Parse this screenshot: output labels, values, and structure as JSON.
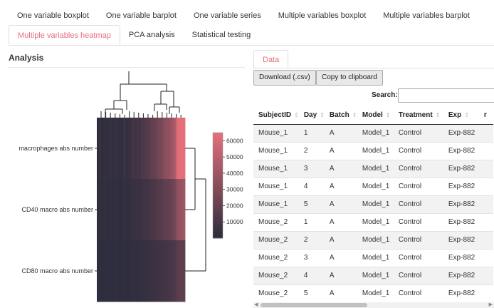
{
  "tabs_row1": [
    {
      "label": "One variable boxplot"
    },
    {
      "label": "One variable barplot"
    },
    {
      "label": "One variable series"
    },
    {
      "label": "Multiple variables boxplot"
    },
    {
      "label": "Multiple variables barplot"
    }
  ],
  "tabs_row2": [
    {
      "label": "Multiple variables heatmap",
      "active": true
    },
    {
      "label": "PCA analysis"
    },
    {
      "label": "Statistical testing"
    }
  ],
  "analysis": {
    "title": "Analysis"
  },
  "heatmap": {
    "row_labels": [
      "macrophages abs number",
      "CD40 macro abs number",
      "CD80 macro abs number"
    ],
    "legend_ticks": [
      60000,
      50000,
      40000,
      30000,
      20000,
      10000
    ],
    "legend_range": [
      0,
      65000
    ],
    "color_low": "#2d2d3e",
    "color_high": "#e46f7a"
  },
  "data_panel": {
    "tab_label": "Data",
    "download_label": "Download (.csv)",
    "clipboard_label": "Copy to clipboard",
    "search_label": "Search:",
    "search_value": ""
  },
  "table": {
    "columns": [
      "SubjectID",
      "Day",
      "Batch",
      "Model",
      "Treatment",
      "Exp",
      "r"
    ],
    "rows": [
      [
        "Mouse_1",
        "1",
        "A",
        "Model_1",
        "Control",
        "Exp-882"
      ],
      [
        "Mouse_1",
        "2",
        "A",
        "Model_1",
        "Control",
        "Exp-882"
      ],
      [
        "Mouse_1",
        "3",
        "A",
        "Model_1",
        "Control",
        "Exp-882"
      ],
      [
        "Mouse_1",
        "4",
        "A",
        "Model_1",
        "Control",
        "Exp-882"
      ],
      [
        "Mouse_1",
        "5",
        "A",
        "Model_1",
        "Control",
        "Exp-882"
      ],
      [
        "Mouse_2",
        "1",
        "A",
        "Model_1",
        "Control",
        "Exp-882"
      ],
      [
        "Mouse_2",
        "2",
        "A",
        "Model_1",
        "Control",
        "Exp-882"
      ],
      [
        "Mouse_2",
        "3",
        "A",
        "Model_1",
        "Control",
        "Exp-882"
      ],
      [
        "Mouse_2",
        "4",
        "A",
        "Model_1",
        "Control",
        "Exp-882"
      ],
      [
        "Mouse_2",
        "5",
        "A",
        "Model_1",
        "Control",
        "Exp-882"
      ]
    ]
  },
  "colors": {
    "accent": "#e46f7a"
  }
}
